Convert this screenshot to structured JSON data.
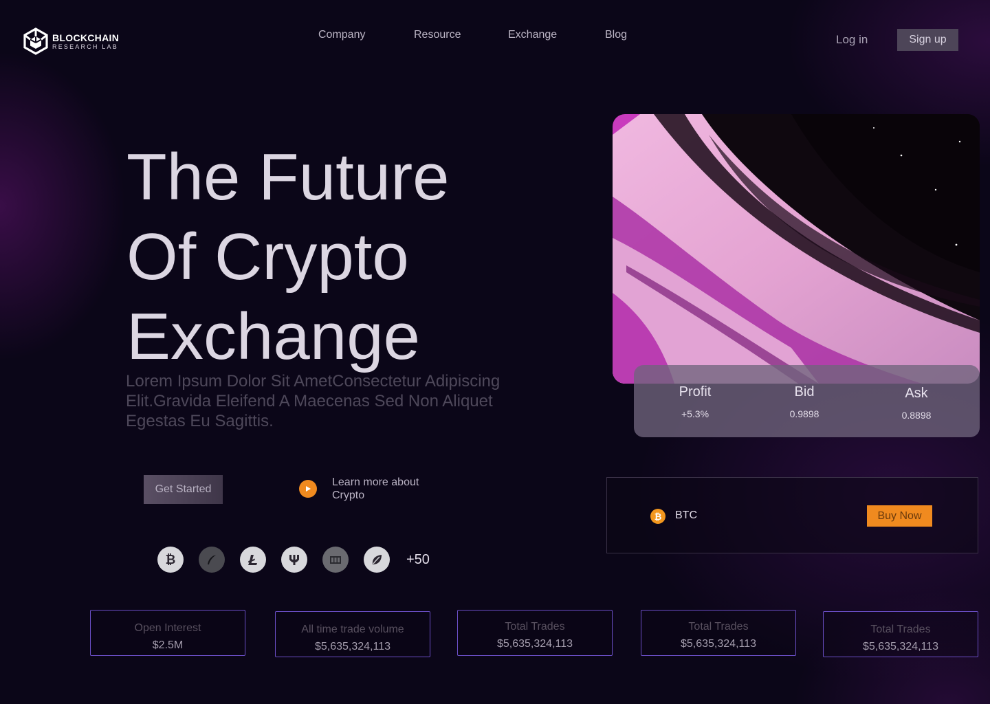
{
  "brand": {
    "name": "BLOCKCHAIN",
    "subtitle": "RESEARCH LAB"
  },
  "nav": {
    "items": [
      {
        "label": "Company"
      },
      {
        "label": "Resource"
      },
      {
        "label": "Exchange"
      },
      {
        "label": "Blog"
      }
    ],
    "login_label": "Log in",
    "signup_label": "Sign up"
  },
  "hero": {
    "title_lines": [
      "The Future",
      "Of Crypto",
      "Exchange"
    ],
    "subtitle": "Lorem Ipsum Dolor Sit AmetConsectetur Adipiscing Elit.Gravida Eleifend A Maecenas Sed Non Aliquet Egestas Eu Sagittis.",
    "cta_label": "Get Started",
    "learn_more": "Learn more about Crypto",
    "coin_icons": [
      "bitcoin-icon",
      "feather-icon",
      "litecoin-icon",
      "trident-icon",
      "book-icon",
      "leaf-icon"
    ],
    "more_coins": "+50"
  },
  "ticker": {
    "items": [
      {
        "label": "Profit",
        "value": "+5.3%"
      },
      {
        "label": "Bid",
        "value": "0.9898"
      },
      {
        "label": "Ask",
        "value": "0.8898"
      }
    ]
  },
  "trade": {
    "asset": "BTC",
    "buy_label": "Buy Now"
  },
  "metrics": [
    {
      "label": "Open Interest",
      "value": "$2.5M"
    },
    {
      "label": "All time trade volume",
      "value": "$5,635,324,113"
    },
    {
      "label": "Total Trades",
      "value": "$5,635,324,113"
    },
    {
      "label": "Total Trades",
      "value": "$5,635,324,113"
    },
    {
      "label": "Total Trades",
      "value": "$5,635,324,113"
    }
  ],
  "colors": {
    "background": "#0b0618",
    "accent_orange": "#f08a1f",
    "metric_border": "#6b4fc7",
    "art_pink": "#e3a6d3",
    "art_purple": "#9b2aa3"
  }
}
